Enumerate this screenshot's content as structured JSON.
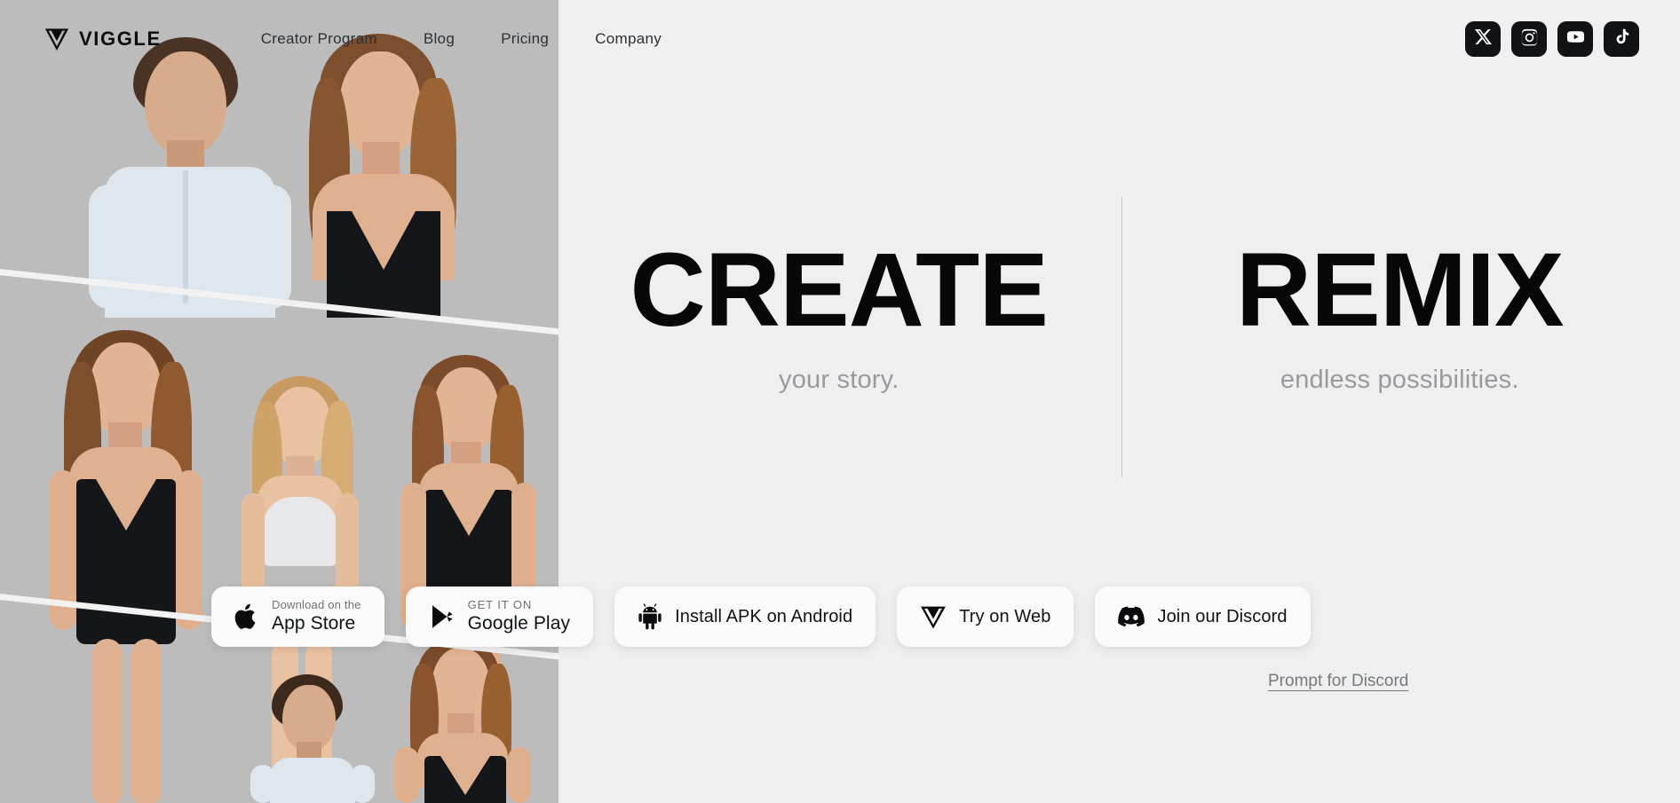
{
  "brand": {
    "name": "VIGGLE",
    "logo_icon": "viggle-v-logo-icon"
  },
  "nav": {
    "links": [
      {
        "label": "Creator Program"
      },
      {
        "label": "Blog"
      },
      {
        "label": "Pricing"
      },
      {
        "label": "Company"
      }
    ],
    "socials": [
      {
        "name": "x-twitter-icon",
        "label": "X"
      },
      {
        "name": "instagram-icon",
        "label": "Instagram"
      },
      {
        "name": "youtube-icon",
        "label": "YouTube"
      },
      {
        "name": "tiktok-icon",
        "label": "TikTok"
      }
    ]
  },
  "hero": {
    "left": {
      "title": "CREATE",
      "subtitle": "your story."
    },
    "right": {
      "title": "REMIX",
      "subtitle": "endless possibilities."
    }
  },
  "cta": {
    "app_store": {
      "small": "Download on the",
      "big": "App Store",
      "icon": "apple-icon"
    },
    "google_play": {
      "small": "GET IT ON",
      "big": "Google Play",
      "icon": "google-play-icon"
    },
    "android_apk": {
      "label": "Install APK on Android",
      "icon": "android-robot-icon"
    },
    "try_web": {
      "label": "Try on Web",
      "icon": "viggle-v-logo-icon"
    },
    "discord": {
      "label": "Join our Discord",
      "icon": "discord-icon"
    },
    "prompt_link": {
      "label": "Prompt for Discord"
    }
  },
  "colors": {
    "page_background": "#efefef",
    "collage_background": "#bcbcbc",
    "text_primary": "#080809",
    "text_muted": "#9a9a9d",
    "button_background": "#fafafa",
    "social_background": "#111215",
    "divider": "#c9c9c9"
  }
}
